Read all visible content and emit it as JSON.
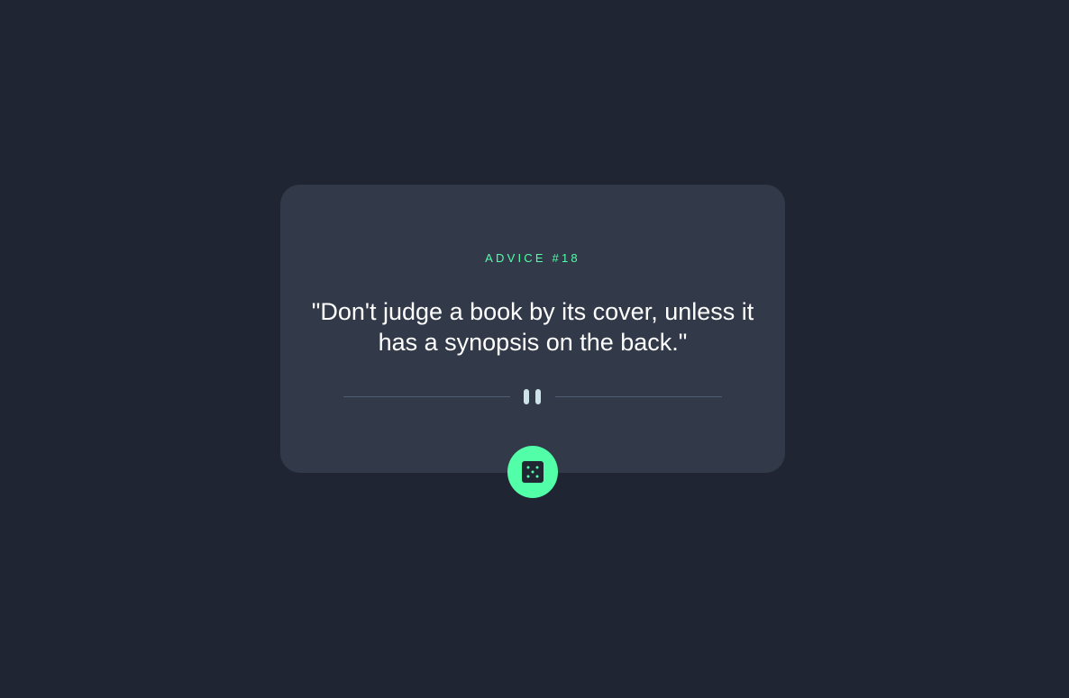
{
  "advice": {
    "id_label": "ADVICE #18",
    "quote": "\"Don't judge a book by its cover, unless it has a synopsis on the back.\""
  },
  "divider": {
    "icon": "pause-icon"
  },
  "button": {
    "icon": "dice-icon"
  },
  "colors": {
    "background": "#1f2532",
    "card": "#323a49",
    "accent": "#52ffa8",
    "text": "#ffffff",
    "divider_line": "#4f5d74",
    "pause": "#cee3e9"
  }
}
